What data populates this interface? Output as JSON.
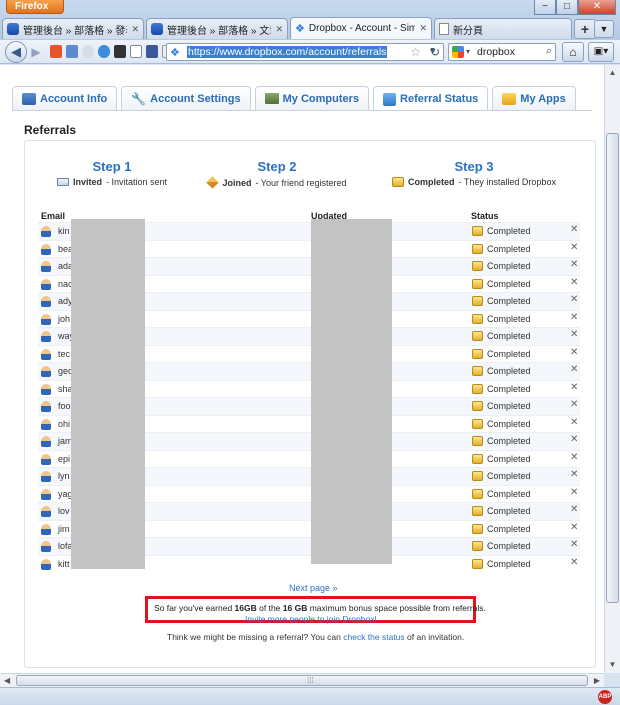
{
  "browser": {
    "menu_button": "Firefox",
    "window_controls": {
      "minimize": "−",
      "maximize": "□",
      "close": "✕"
    },
    "tabs": [
      {
        "label": "管理後台 » 部落格 » 發表文...",
        "close": "✕"
      },
      {
        "label": "管理後台 » 部落格 » 文章列...",
        "close": "✕"
      },
      {
        "label": "Dropbox - Account - Sim...",
        "close": "✕"
      },
      {
        "label": "新分頁",
        "close": ""
      }
    ],
    "newtab": "+",
    "url": "https://www.dropbox.com/account/referrals",
    "search_engine_query": "dropbox"
  },
  "account_tabs": [
    {
      "label": "Account Info",
      "icon": "user-card-icon"
    },
    {
      "label": "Account Settings",
      "icon": "wrench-icon"
    },
    {
      "label": "My Computers",
      "icon": "computers-icon"
    },
    {
      "label": "Referral Status",
      "icon": "referral-icon"
    },
    {
      "label": "My Apps",
      "icon": "apps-icon"
    }
  ],
  "active_tab": "Referral Status",
  "referrals": {
    "heading": "Referrals",
    "steps": [
      {
        "title": "Step 1",
        "state": "Invited",
        "desc": " - Invitation sent",
        "icon": "envelope-icon"
      },
      {
        "title": "Step 2",
        "state": "Joined",
        "desc": " - Your friend registered",
        "icon": "pencil-icon"
      },
      {
        "title": "Step 3",
        "state": "Completed",
        "desc": " - They installed Dropbox",
        "icon": "crown-icon"
      }
    ],
    "columns": {
      "email": "Email",
      "updated": "Updated",
      "status": "Status"
    },
    "rows": [
      {
        "email": "kin",
        "status": "Completed"
      },
      {
        "email": "bea",
        "status": "Completed"
      },
      {
        "email": "ada",
        "status": "Completed"
      },
      {
        "email": "nac",
        "status": "Completed"
      },
      {
        "email": "ady",
        "status": "Completed"
      },
      {
        "email": "joh",
        "status": "Completed"
      },
      {
        "email": "way",
        "status": "Completed"
      },
      {
        "email": "tec",
        "status": "Completed"
      },
      {
        "email": "gec",
        "status": "Completed"
      },
      {
        "email": "sha",
        "status": "Completed"
      },
      {
        "email": "foo",
        "status": "Completed"
      },
      {
        "email": "ohi",
        "status": "Completed"
      },
      {
        "email": "jam",
        "status": "Completed"
      },
      {
        "email": "epi",
        "status": "Completed"
      },
      {
        "email": "lyn",
        "status": "Completed"
      },
      {
        "email": "yag",
        "status": "Completed"
      },
      {
        "email": "lov",
        "status": "Completed"
      },
      {
        "email": "jim",
        "status": "Completed"
      },
      {
        "email": "lofa",
        "status": "Completed"
      },
      {
        "email": "kitt",
        "status": "Completed"
      }
    ],
    "remove_glyph": "✕",
    "next_page": "Next page »",
    "earned": {
      "prefix": "So far you've earned ",
      "earned_amount": "16GB",
      "middle": " of the ",
      "max_amount": "16 GB",
      "suffix": " maximum bonus space possible from referrals."
    },
    "invite_link": "Invite more people to join Dropbox!",
    "missing_prefix": "Think we might be missing a referral? You can ",
    "missing_link": "check the status",
    "missing_suffix": " of an invitation."
  }
}
